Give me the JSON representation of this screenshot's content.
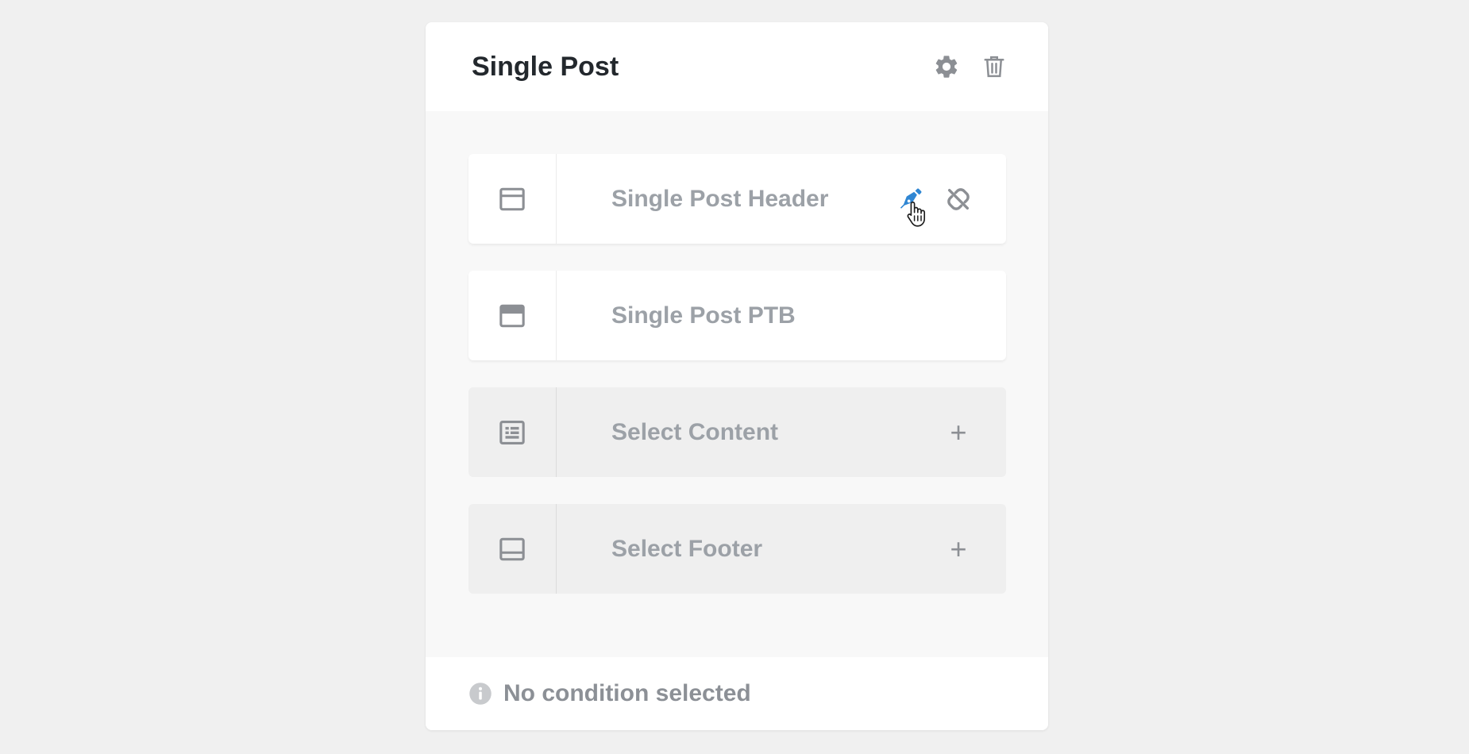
{
  "colors": {
    "accent": "#2f86d3",
    "icon_gray": "#8c8f94",
    "title": "#23282d",
    "label_gray": "#9ca1a7"
  },
  "card": {
    "title": "Single Post",
    "header_icons": [
      "gear-icon",
      "trash-icon"
    ]
  },
  "slots": [
    {
      "label": "Single Post Header",
      "icon": "header-layout-icon",
      "state": "assigned",
      "actions": [
        "edit-pen-icon",
        "unlink-icon"
      ]
    },
    {
      "label": "Single Post PTB",
      "icon": "page-title-bar-icon",
      "state": "assigned",
      "actions": []
    },
    {
      "label": "Select Content",
      "icon": "content-layout-icon",
      "state": "empty",
      "actions": [
        "plus-icon"
      ],
      "action_text": "+"
    },
    {
      "label": "Select Footer",
      "icon": "footer-layout-icon",
      "state": "empty",
      "actions": [
        "plus-icon"
      ],
      "action_text": "+"
    }
  ],
  "footer": {
    "icon": "info-icon",
    "text": "No condition selected"
  }
}
